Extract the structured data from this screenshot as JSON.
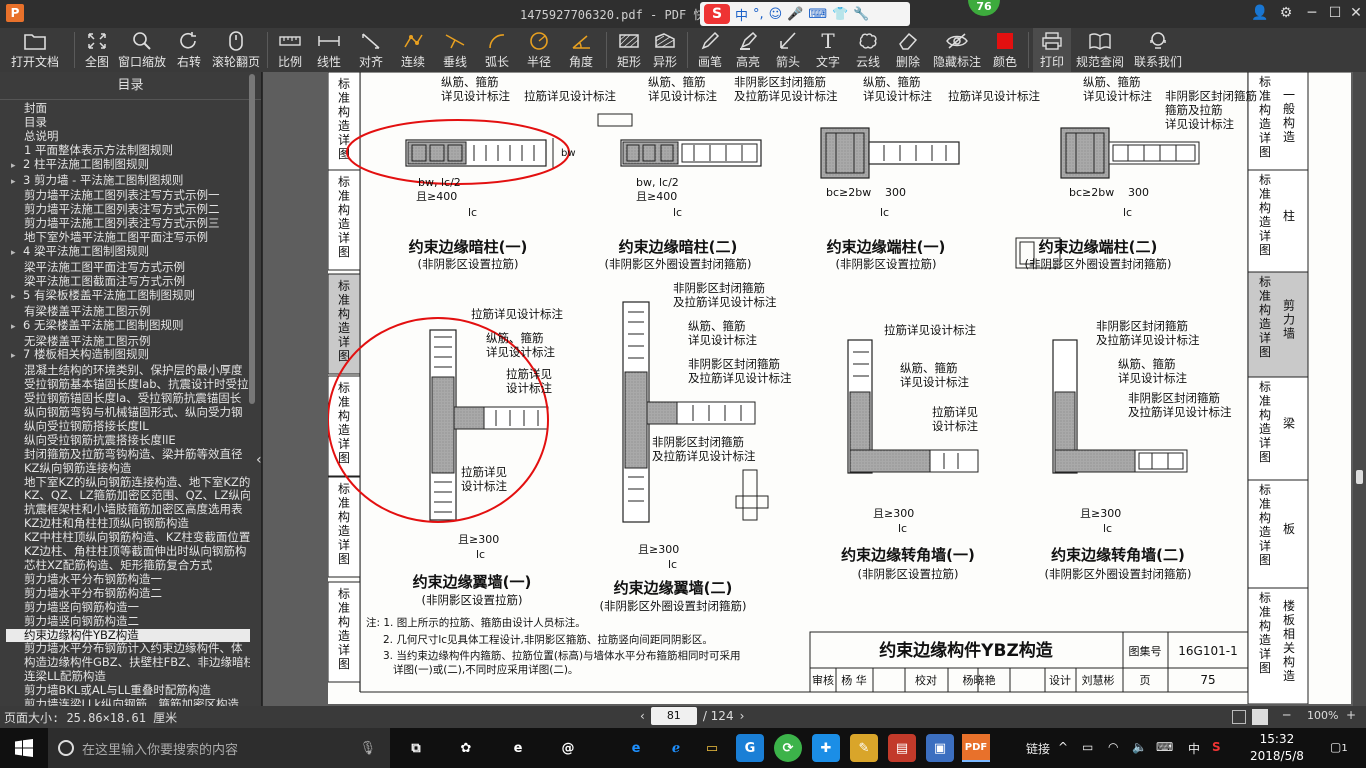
{
  "window": {
    "title": "1475927706320.pdf - PDF 快速看图",
    "app_logo": "P",
    "badge": "76"
  },
  "ime": {
    "logo": "S",
    "items": [
      "中",
      "°,",
      "☺",
      "🎤",
      "⌨",
      "👕",
      "🔧"
    ]
  },
  "toolbar": {
    "buttons": [
      {
        "label": "打开文档",
        "icon": "folder-icon"
      },
      {
        "label": "全图",
        "icon": "fit-icon"
      },
      {
        "label": "窗口缩放",
        "icon": "zoom-icon"
      },
      {
        "label": "右转",
        "icon": "rotate-icon"
      },
      {
        "label": "滚轮翻页",
        "icon": "mouse-icon"
      },
      {
        "label": "比例",
        "icon": "ruler-icon"
      },
      {
        "label": "线性",
        "icon": "linear-icon"
      },
      {
        "label": "对齐",
        "icon": "align-icon"
      },
      {
        "label": "连续",
        "icon": "continuous-icon"
      },
      {
        "label": "垂线",
        "icon": "perpendicular-icon"
      },
      {
        "label": "弧长",
        "icon": "arc-icon"
      },
      {
        "label": "半径",
        "icon": "radius-icon"
      },
      {
        "label": "角度",
        "icon": "angle-icon"
      },
      {
        "label": "矩形",
        "icon": "rectangle-icon"
      },
      {
        "label": "异形",
        "icon": "shape-icon"
      },
      {
        "label": "画笔",
        "icon": "pen-icon"
      },
      {
        "label": "高亮",
        "icon": "highlight-icon"
      },
      {
        "label": "箭头",
        "icon": "arrow-icon"
      },
      {
        "label": "文字",
        "icon": "text-icon"
      },
      {
        "label": "云线",
        "icon": "cloud-icon"
      },
      {
        "label": "删除",
        "icon": "eraser-icon"
      },
      {
        "label": "隐藏标注",
        "icon": "eye-off-icon"
      },
      {
        "label": "颜色",
        "icon": "color-icon",
        "color": "#e31010"
      },
      {
        "label": "打印",
        "icon": "print-icon"
      },
      {
        "label": "规范查阅",
        "icon": "book-icon"
      },
      {
        "label": "联系我们",
        "icon": "contact-icon"
      }
    ]
  },
  "sidebar": {
    "header": "目录",
    "items": [
      {
        "text": "封面",
        "level": 0
      },
      {
        "text": "目录",
        "level": 0
      },
      {
        "text": "总说明",
        "level": 0
      },
      {
        "text": "1 平面整体表示方法制图规则",
        "level": 0
      },
      {
        "text": "2 柱平法施工图制图规则",
        "level": 0,
        "expandable": true
      },
      {
        "text": "3 剪力墙 - 平法施工图制图规则",
        "level": 0,
        "expandable": true
      },
      {
        "text": "剪力墙平法施工图列表注写方式示例一",
        "level": 1
      },
      {
        "text": "剪力墙平法施工图列表注写方式示例二",
        "level": 1
      },
      {
        "text": "剪力墙平法施工图列表注写方式示例三",
        "level": 1
      },
      {
        "text": "地下室外墙平法施工图平面注写示例",
        "level": 1
      },
      {
        "text": "4 梁平法施工图制图规则",
        "level": 0,
        "expandable": true
      },
      {
        "text": "梁平法施工图平面注写方式示例",
        "level": 1
      },
      {
        "text": "梁平法施工图截面注写方式示例",
        "level": 1
      },
      {
        "text": "5 有梁板楼盖平法施工图制图规则",
        "level": 0,
        "expandable": true
      },
      {
        "text": "有梁楼盖平法施工图示例",
        "level": 1
      },
      {
        "text": "6 无梁楼盖平法施工图制图规则",
        "level": 0,
        "expandable": true
      },
      {
        "text": "无梁楼盖平法施工图示例",
        "level": 1
      },
      {
        "text": "7 楼板相关构造制图规则",
        "level": 0,
        "expandable": true
      },
      {
        "text": "混凝土结构的环境类别、保护层的最小厚度",
        "level": 1
      },
      {
        "text": "受拉钢筋基本锚固长度lab、抗震设计时受拉",
        "level": 1
      },
      {
        "text": "受拉钢筋锚固长度la、受拉钢筋抗震锚固长",
        "level": 1
      },
      {
        "text": "纵向钢筋弯钩与机械锚固形式、纵向受力钢",
        "level": 1
      },
      {
        "text": "纵向受拉钢筋搭接长度lL",
        "level": 1
      },
      {
        "text": "纵向受拉钢筋抗震搭接长度llE",
        "level": 1
      },
      {
        "text": "封闭箍筋及拉筋弯钩构造、梁并筋等效直径",
        "level": 1
      },
      {
        "text": "KZ纵向钢筋连接构造",
        "level": 1
      },
      {
        "text": "地下室KZ的纵向钢筋连接构造、地下室KZ的",
        "level": 1
      },
      {
        "text": "KZ、QZ、LZ箍筋加密区范围、QZ、LZ纵向钢",
        "level": 1
      },
      {
        "text": "抗震框架柱和小墙肢箍筋加密区高度选用表",
        "level": 1
      },
      {
        "text": "KZ边柱和角柱柱顶纵向钢筋构造",
        "level": 1
      },
      {
        "text": "KZ中柱柱顶纵向钢筋构造、KZ柱变截面位置",
        "level": 1
      },
      {
        "text": "KZ边柱、角柱柱顶等截面伸出时纵向钢筋构",
        "level": 1
      },
      {
        "text": "芯柱XZ配筋构造、矩形箍筋复合方式",
        "level": 1
      },
      {
        "text": "剪力墙水平分布钢筋构造一",
        "level": 1
      },
      {
        "text": "剪力墙水平分布钢筋构造二",
        "level": 1
      },
      {
        "text": "剪力墙竖向钢筋构造一",
        "level": 1
      },
      {
        "text": "剪力墙竖向钢筋构造二",
        "level": 1
      },
      {
        "text": "约束边缘构件YBZ构造",
        "level": 1,
        "selected": true
      },
      {
        "text": "剪力墙水平分布钢筋计入约束边缘构件、体",
        "level": 1
      },
      {
        "text": "构造边缘构件GBZ、扶壁柱FBZ、非边缘暗柱",
        "level": 1
      },
      {
        "text": "连梁LL配筋构造",
        "level": 1
      },
      {
        "text": "剪力墙BKL或AL与LL重叠时配筋构造",
        "level": 1
      },
      {
        "text": "剪力墙连梁LLk纵向钢筋、箍筋加密区构造",
        "level": 1
      }
    ]
  },
  "drawing": {
    "right_tabs": [
      {
        "text": "标准构造详图",
        "sub": "一般构造"
      },
      {
        "text": "标准构造详图",
        "sub": "柱"
      },
      {
        "text": "标准构造详图",
        "sub": "剪力墙",
        "active": true
      },
      {
        "text": "标准构造详图",
        "sub": "梁"
      },
      {
        "text": "标准构造详图",
        "sub": "板"
      },
      {
        "text": "标准构造详图",
        "sub": "楼板相关构造"
      }
    ],
    "left_tabs": [
      "标准构造详图",
      "标准构造详图",
      "标准构造详图",
      "标准构造详图",
      "标准构造详图",
      "标准构造详图"
    ],
    "labels": {
      "zongjin_gujin": "纵筋、箍筋",
      "xiangjian_sheji": "详见设计标注",
      "lajin_xiangjian": "拉筋详见设计标注",
      "feiyinying_fengbi": "非阴影区封闭箍筋",
      "jilajin_xiangjian": "及拉筋详见设计标注",
      "lajin_xiang": "拉筋详见",
      "sheji_biaozhu": "设计标注",
      "qie300": "且≥300",
      "qie400": "且≥400",
      "bw_lc2": "bw, lc/2",
      "bc_2bw": "bc≥2bw",
      "hc_2bw": "hc≥2bw",
      "n300": "300",
      "lc": "lc",
      "bw": "bw",
      "bf": "bf",
      "twobf": "2bf"
    },
    "titles": [
      {
        "main": "约束边缘暗柱(一)",
        "sub": "(非阴影区设置拉筋)"
      },
      {
        "main": "约束边缘暗柱(二)",
        "sub": "(非阴影区外圈设置封闭箍筋)"
      },
      {
        "main": "约束边缘端柱(一)",
        "sub": "(非阴影区设置拉筋)"
      },
      {
        "main": "约束边缘端柱(二)",
        "sub": "(非阴影区外圈设置封闭箍筋)"
      },
      {
        "main": "约束边缘翼墙(一)",
        "sub": "(非阴影区设置拉筋)"
      },
      {
        "main": "约束边缘翼墙(二)",
        "sub": "(非阴影区外圈设置封闭箍筋)"
      },
      {
        "main": "约束边缘转角墙(一)",
        "sub": "(非阴影区设置拉筋)"
      },
      {
        "main": "约束边缘转角墙(二)",
        "sub": "(非阴影区外圈设置封闭箍筋)"
      }
    ],
    "notes": [
      "注: 1. 图上所示的拉筋、箍筋由设计人员标注。",
      "2. 几何尺寸lc见具体工程设计,非阴影区箍筋、拉筋竖向间距同阴影区。",
      "3. 当约束边缘构件内箍筋、拉筋位置(标高)与墙体水平分布箍筋相同时可采用",
      "详图(一)或(二),不同时应采用详图(二)。"
    ],
    "title_block": {
      "title": "约束边缘构件YBZ构造",
      "atlas_label": "图集号",
      "atlas_no": "16G101-1",
      "review": "审核",
      "reviewer": "杨 华",
      "check": "校对",
      "checker": "杨晓艳",
      "design": "设计",
      "designer": "刘慧彬",
      "page_label": "页",
      "page_no": "75"
    }
  },
  "status": {
    "page_size": "页面大小: 25.86×18.61 厘米",
    "current_page": "81",
    "total_pages": "/ 124",
    "zoom": "100%"
  },
  "taskbar": {
    "search_placeholder": "在这里输入你要搜索的内容",
    "tray_link": "链接",
    "ime": "中",
    "time": "15:32",
    "date": "2018/5/8",
    "notification_count": "1"
  }
}
